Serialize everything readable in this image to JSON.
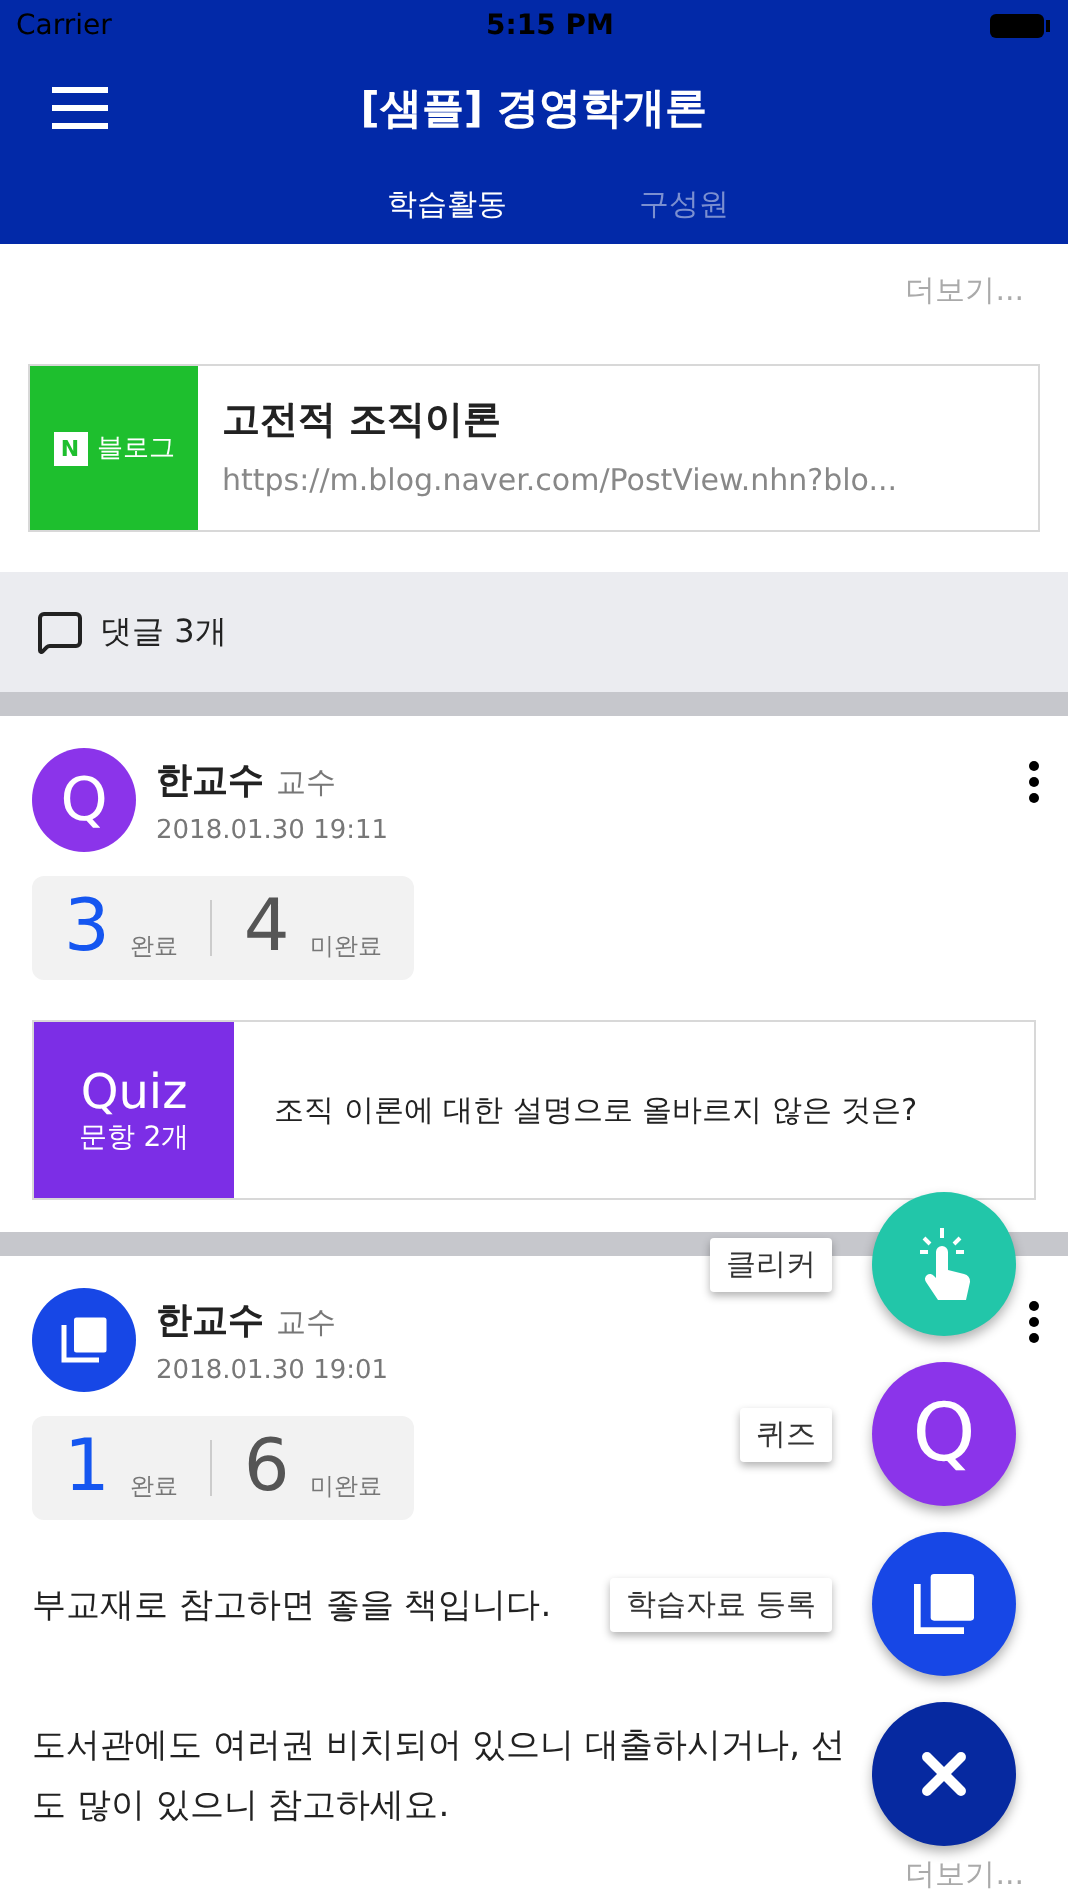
{
  "status_bar": {
    "carrier": "Carrier",
    "time": "5:15 PM"
  },
  "header": {
    "title": "[샘플] 경영학개론",
    "tabs": [
      {
        "label": "학습활동",
        "selected": true
      },
      {
        "label": "구성원",
        "selected": false
      }
    ]
  },
  "top_post": {
    "more": "더보기...",
    "link_card": {
      "logo_letter": "N",
      "source": "블로그",
      "title": "고전적 조직이론",
      "url": "https://m.blog.naver.com/PostView.nhn?blo..."
    },
    "comments": "댓글 3개"
  },
  "posts": [
    {
      "kind": "quiz",
      "avatar_letter": "Q",
      "author": "한교수",
      "role": "교수",
      "date": "2018.01.30 19:11",
      "done": "3",
      "done_label": "완료",
      "pending": "4",
      "pending_label": "미완료",
      "quiz": {
        "label": "Quiz",
        "count": "문항 2개",
        "question": "조직 이론에 대한 설명으로 올바르지 않은 것은?"
      }
    },
    {
      "kind": "material",
      "author": "한교수",
      "role": "교수",
      "date": "2018.01.30 19:01",
      "done": "1",
      "done_label": "완료",
      "pending": "6",
      "pending_label": "미완료",
      "paragraphs": [
        "부교재로 참고하면 좋을 책입니다.",
        "도서관에도 여러권 비치되어 있으니 대출하시거나, 선",
        "도 많이 있으니 참고하세요."
      ],
      "more": "더보기..."
    }
  ],
  "fab_menu": {
    "items": [
      {
        "kind": "clicker",
        "label": "클리커"
      },
      {
        "kind": "quiz",
        "label": "퀴즈",
        "letter": "Q"
      },
      {
        "kind": "material",
        "label": "학습자료 등록"
      }
    ]
  }
}
